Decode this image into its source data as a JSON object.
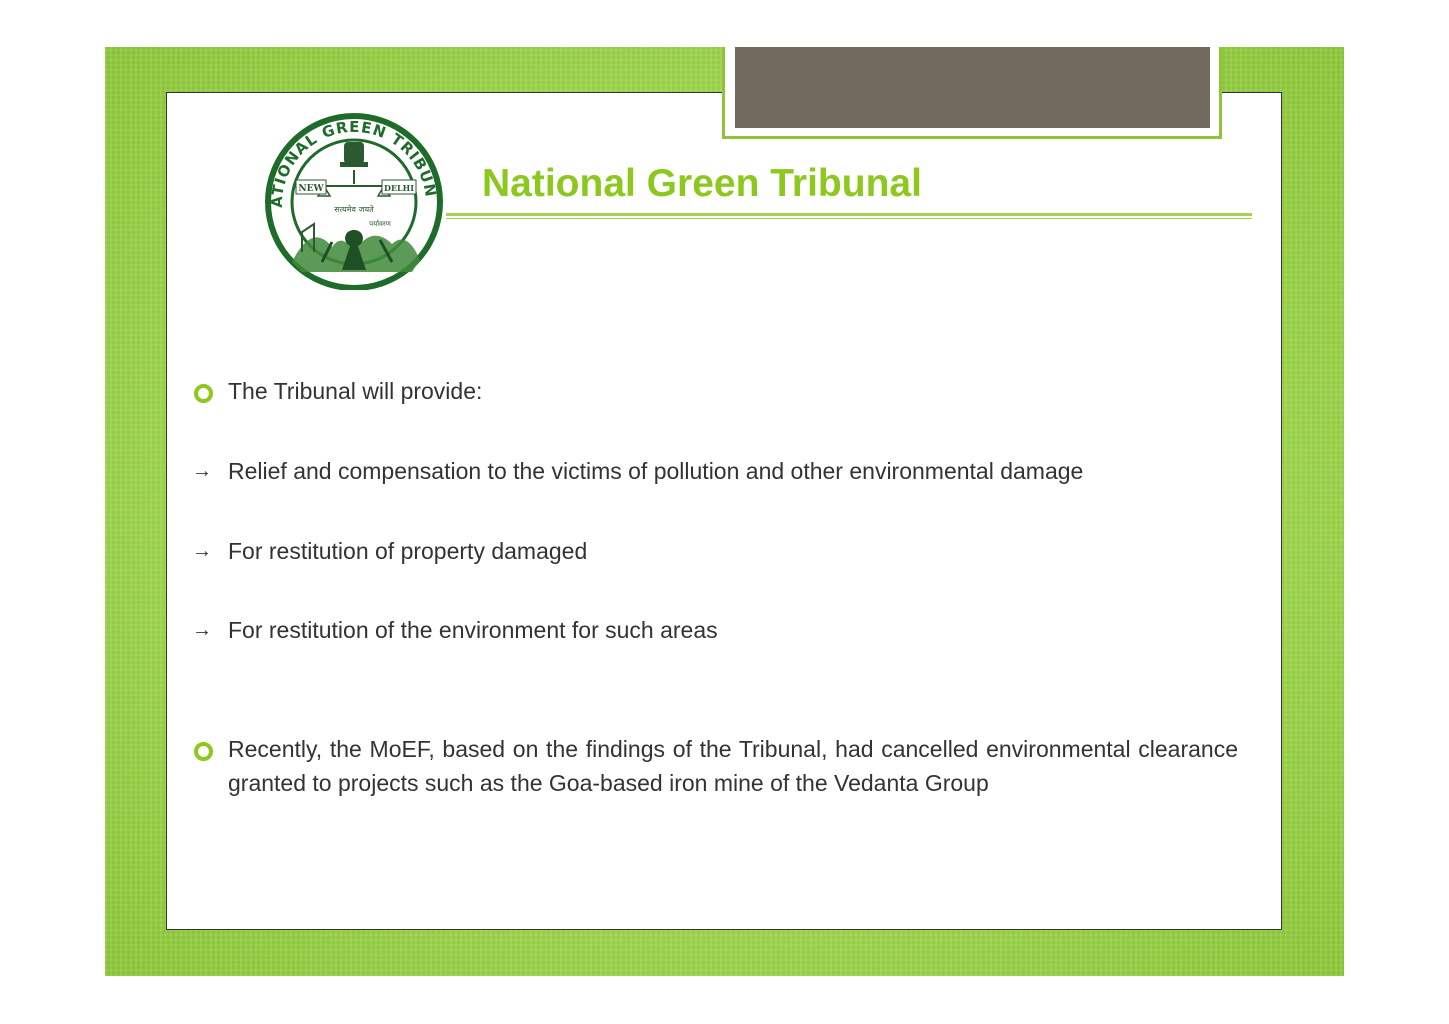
{
  "slide": {
    "title": "National Green Tribunal",
    "logo": {
      "ring_top_text": "NATIONAL GREEN TRIBUNAL",
      "left_text": "NEW",
      "right_text": "DELHI",
      "motto_line1": "सत्यमेव जयते",
      "motto_line2": "पर्यावरण"
    },
    "colors": {
      "accent": "#8cc81e",
      "background_green": "#9bd24a",
      "tab": "#726a5c",
      "text": "#333333"
    },
    "items": [
      {
        "marker": "circle-bullet",
        "text": "The Tribunal will provide:"
      },
      {
        "marker": "arrow",
        "glyph": "→",
        "text": "Relief and compensation to the victims of pollution and other environmental damage"
      },
      {
        "marker": "arrow",
        "glyph": "→",
        "text": "For restitution of property damaged"
      },
      {
        "marker": "arrow",
        "glyph": "→",
        "text": "For restitution of the environment for such areas"
      },
      {
        "marker": "circle-bullet",
        "text": "Recently, the MoEF, based on the findings of the Tribunal, had cancelled environmental clearance granted to projects such as the Goa-based iron mine of the Vedanta Group"
      }
    ]
  }
}
